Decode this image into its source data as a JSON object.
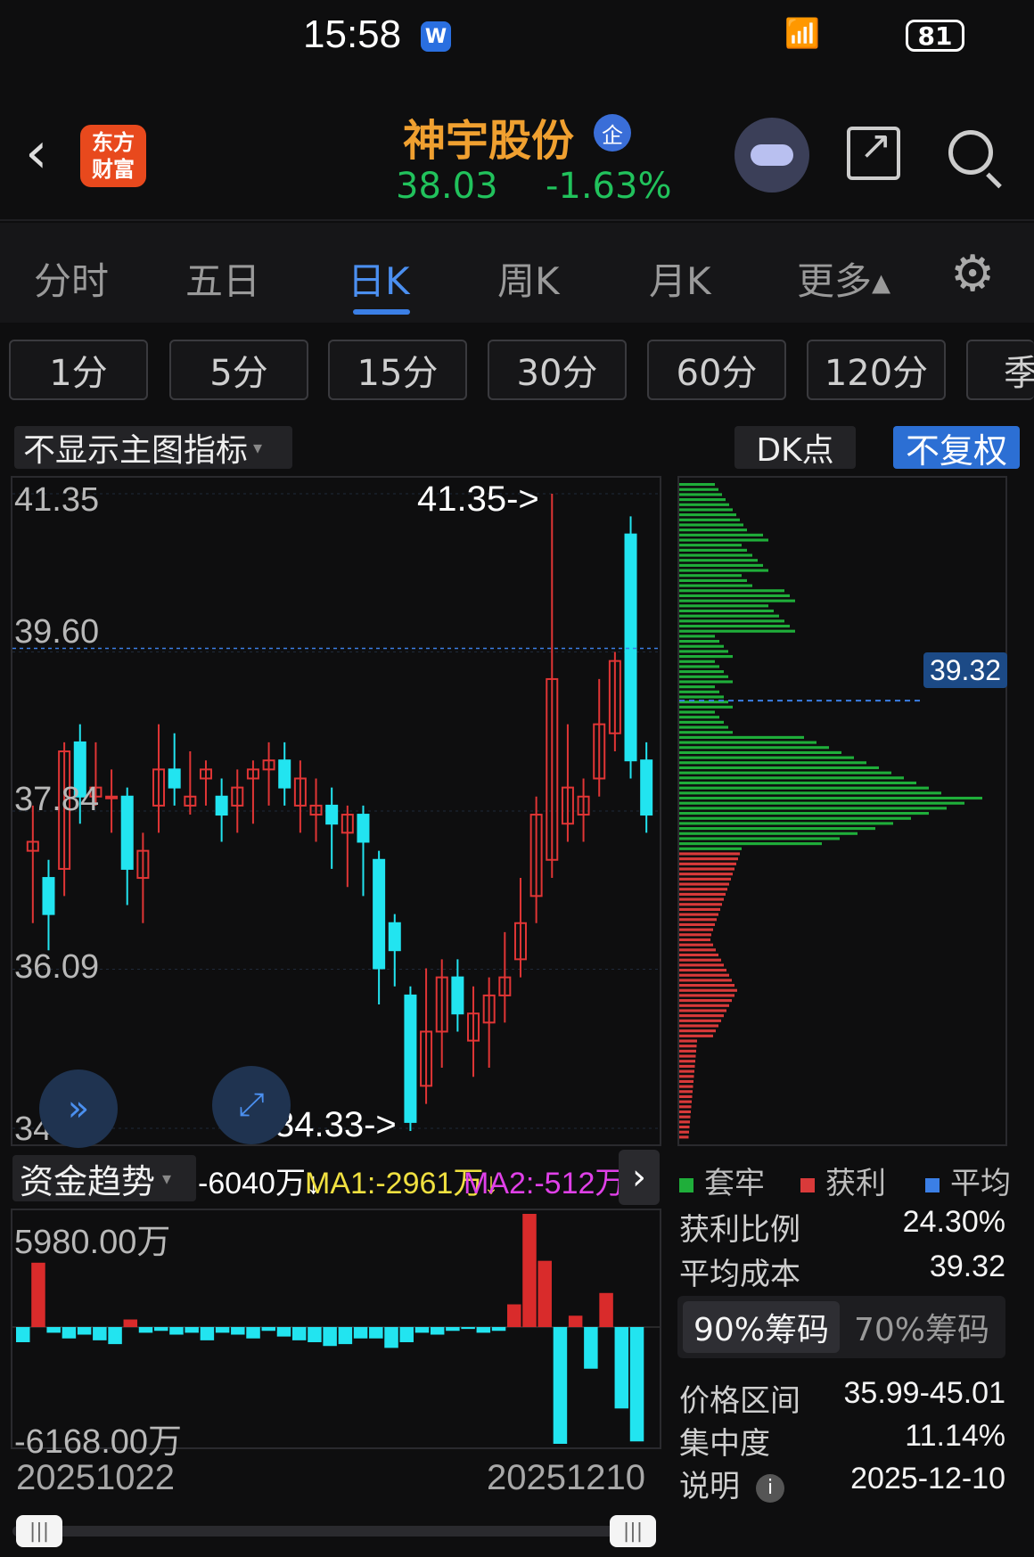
{
  "status_bar": {
    "time": "15:58",
    "badge": "W",
    "battery": "81"
  },
  "header": {
    "logo_line1": "东方",
    "logo_line2": "财富",
    "stock_name": "神宇股份",
    "badge": "企",
    "price": "38.03",
    "change_pct": "-1.63%",
    "price_color": "#21c25c",
    "name_color": "#f0a030"
  },
  "tabs": [
    "分时",
    "五日",
    "日K",
    "周K",
    "月K",
    "更多▴"
  ],
  "active_tab": "日K",
  "periods": [
    "1分",
    "5分",
    "15分",
    "30分",
    "60分",
    "120分",
    "季"
  ],
  "indicator_select": "不显示主图指标",
  "dk_button": "DK点",
  "adjust_button": "不复权",
  "price_axis": [
    "41.35",
    "39.60",
    "37.84",
    "36.09",
    "34.33"
  ],
  "high_marker": "41.35->",
  "low_marker": "34.33->",
  "avg_cost_tag": "39.32",
  "flow": {
    "select": "资金趋势",
    "value": "-6040万↓",
    "ma1": "MA1:-2961万↓",
    "ma2": "MA2:-512万↓",
    "max_label": "5980.00万",
    "min_label": "-6168.00万"
  },
  "dates": {
    "start": "20251022",
    "end": "20251210"
  },
  "chip_panel": {
    "legend": [
      "套牢",
      "获利",
      "平均"
    ],
    "legend_colors": [
      "#1fae3a",
      "#d93a3a",
      "#3b7fe6"
    ],
    "profit_ratio_label": "获利比例",
    "profit_ratio": "24.30%",
    "avg_cost_label": "平均成本",
    "avg_cost": "39.32",
    "tab_90": "90%筹码",
    "tab_70": "70%筹码",
    "range_label": "价格区间",
    "range": "35.99-45.01",
    "concentration_label": "集中度",
    "concentration": "11.14%",
    "note_label": "说明",
    "note_date": "2025-12-10"
  },
  "chart_data": {
    "type": "candlestick",
    "ylim": [
      34.33,
      41.35
    ],
    "high": 41.35,
    "low": 34.33,
    "candles": [
      {
        "o": 37.4,
        "c": 37.5,
        "h": 37.9,
        "l": 36.6
      },
      {
        "o": 37.1,
        "c": 36.7,
        "h": 37.3,
        "l": 36.3
      },
      {
        "o": 37.2,
        "c": 38.5,
        "h": 38.6,
        "l": 36.9
      },
      {
        "o": 38.6,
        "c": 38.0,
        "h": 38.8,
        "l": 37.7
      },
      {
        "o": 38.0,
        "c": 38.1,
        "h": 38.6,
        "l": 37.9
      },
      {
        "o": 38.0,
        "c": 38.0,
        "h": 38.3,
        "l": 37.6
      },
      {
        "o": 38.0,
        "c": 37.2,
        "h": 38.1,
        "l": 36.8
      },
      {
        "o": 37.1,
        "c": 37.4,
        "h": 37.6,
        "l": 36.6
      },
      {
        "o": 37.9,
        "c": 38.3,
        "h": 38.8,
        "l": 37.6
      },
      {
        "o": 38.3,
        "c": 38.1,
        "h": 38.7,
        "l": 37.9
      },
      {
        "o": 37.9,
        "c": 38.0,
        "h": 38.5,
        "l": 37.8
      },
      {
        "o": 38.2,
        "c": 38.3,
        "h": 38.4,
        "l": 37.9
      },
      {
        "o": 38.0,
        "c": 37.8,
        "h": 38.2,
        "l": 37.5
      },
      {
        "o": 37.9,
        "c": 38.1,
        "h": 38.3,
        "l": 37.6
      },
      {
        "o": 38.2,
        "c": 38.3,
        "h": 38.4,
        "l": 37.7
      },
      {
        "o": 38.3,
        "c": 38.4,
        "h": 38.6,
        "l": 37.9
      },
      {
        "o": 38.4,
        "c": 38.1,
        "h": 38.6,
        "l": 37.9
      },
      {
        "o": 37.9,
        "c": 38.2,
        "h": 38.4,
        "l": 37.6
      },
      {
        "o": 37.8,
        "c": 37.9,
        "h": 38.2,
        "l": 37.5
      },
      {
        "o": 37.9,
        "c": 37.7,
        "h": 38.1,
        "l": 37.2
      },
      {
        "o": 37.6,
        "c": 37.8,
        "h": 37.9,
        "l": 37.0
      },
      {
        "o": 37.8,
        "c": 37.5,
        "h": 37.9,
        "l": 36.9
      },
      {
        "o": 37.3,
        "c": 36.1,
        "h": 37.4,
        "l": 35.7
      },
      {
        "o": 36.6,
        "c": 36.3,
        "h": 36.7,
        "l": 35.9
      },
      {
        "o": 35.8,
        "c": 34.4,
        "h": 35.9,
        "l": 34.3
      },
      {
        "o": 34.8,
        "c": 35.4,
        "h": 36.1,
        "l": 34.6
      },
      {
        "o": 35.4,
        "c": 36.0,
        "h": 36.2,
        "l": 35.0
      },
      {
        "o": 36.0,
        "c": 35.6,
        "h": 36.2,
        "l": 35.4
      },
      {
        "o": 35.3,
        "c": 35.6,
        "h": 35.9,
        "l": 34.9
      },
      {
        "o": 35.5,
        "c": 35.8,
        "h": 36.0,
        "l": 35.0
      },
      {
        "o": 35.8,
        "c": 36.0,
        "h": 36.5,
        "l": 35.5
      },
      {
        "o": 36.2,
        "c": 36.6,
        "h": 37.1,
        "l": 36.0
      },
      {
        "o": 36.9,
        "c": 37.8,
        "h": 38.0,
        "l": 36.6
      },
      {
        "o": 37.3,
        "c": 39.3,
        "h": 41.35,
        "l": 37.1
      },
      {
        "o": 37.7,
        "c": 38.1,
        "h": 38.8,
        "l": 37.5
      },
      {
        "o": 37.8,
        "c": 38.0,
        "h": 38.2,
        "l": 37.5
      },
      {
        "o": 38.2,
        "c": 38.8,
        "h": 39.3,
        "l": 38.0
      },
      {
        "o": 38.7,
        "c": 39.5,
        "h": 39.6,
        "l": 38.5
      },
      {
        "o": 40.9,
        "c": 38.4,
        "h": 41.1,
        "l": 38.2
      },
      {
        "o": 38.4,
        "c": 37.8,
        "h": 38.6,
        "l": 37.6
      }
    ],
    "flow_values": [
      -800,
      3400,
      -300,
      -600,
      -400,
      -700,
      -900,
      400,
      -300,
      -200,
      -400,
      -300,
      -700,
      -300,
      -400,
      -600,
      -200,
      -500,
      -700,
      -800,
      -1000,
      -900,
      -600,
      -600,
      -1100,
      -800,
      -300,
      -400,
      -200,
      -100,
      -300,
      -200,
      1200,
      5980,
      3500,
      -6168,
      600,
      -2200,
      1800,
      -4300,
      -6040
    ],
    "price_levels": [
      34.33,
      36.09,
      37.84,
      39.6,
      41.35
    ]
  }
}
